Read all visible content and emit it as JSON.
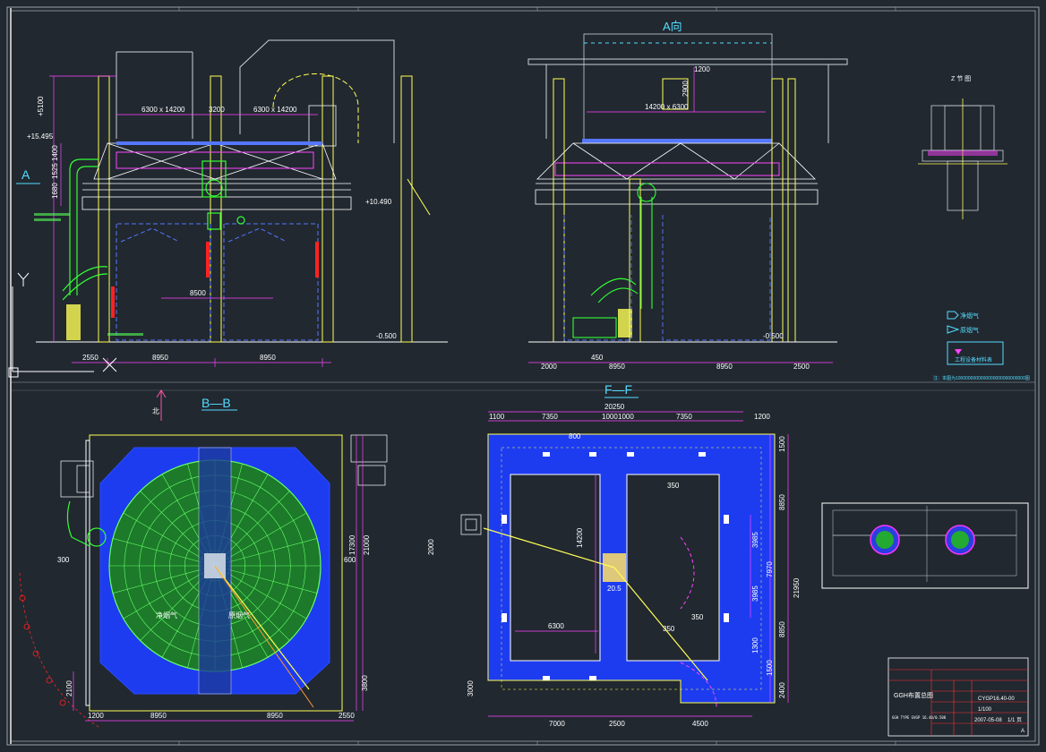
{
  "drawing": {
    "side_view": {
      "dims": {
        "h1": "6300 x 14200",
        "h2": "3200",
        "h3": "6300 x 14200",
        "v_total": "+5100",
        "b1": "2550",
        "b2": "8950",
        "b3": "8950",
        "inner": "8500",
        "el1": "+15.495",
        "el2": "+10.490",
        "el3": "-0.500",
        "v1": "1400",
        "v2": "1525",
        "v3": "1680"
      },
      "section_mark": "A"
    },
    "a_view": {
      "title": "A向",
      "dims": {
        "t1": "1200",
        "t2": "14200 x 6300",
        "t3": "2900",
        "b1": "2000",
        "b2": "450",
        "b3": "8950",
        "b4": "8950",
        "b5": "2500",
        "el": "-0.500"
      }
    },
    "detail_view": {
      "title": "Z 节 图"
    },
    "legend": {
      "item1": "净烟气",
      "item2": "原烟气",
      "box_label": "工程设备材料表",
      "note": "注：本图为1000000000000000000000000000图"
    },
    "bb_view": {
      "title": "B—B",
      "north": "北",
      "label_clean": "净烟气",
      "label_raw": "原烟气",
      "dims": {
        "b1": "1200",
        "b2": "8950",
        "b3": "8950",
        "b4": "2550",
        "r1": "17300",
        "r2": "21000",
        "r3": "3800",
        "l1": "2100",
        "l2": "600",
        "l3": "300"
      }
    },
    "ff_view": {
      "title": "F—F",
      "dims": {
        "top_total": "20250",
        "t1": "1100",
        "t2": "7350",
        "t3": "1000",
        "t4": "1000",
        "t5": "7350",
        "t6": "1200",
        "b1": "7000",
        "b2": "2500",
        "b3": "4500",
        "r1": "1500",
        "r2": "8850",
        "r3": "3985",
        "r4": "7970",
        "r5": "3985",
        "r6": "8850",
        "r7": "1300",
        "r8": "1500",
        "r9": "2400",
        "r10": "21950",
        "w1": "6300",
        "i1": "800",
        "i2": "350",
        "i3": "350",
        "i4": "350",
        "i5": "14200",
        "l1": "2000",
        "l2": "3000",
        "c1": "20.5"
      }
    },
    "title_block": {
      "title": "GGH布置总图",
      "subtitle": "GGH TYPE GVGP 16.40/0.508",
      "code": "CYGP16.40-00",
      "scale": "1/100",
      "date": "2007-05-08",
      "sheet": "1/1 页",
      "rev": "A"
    }
  }
}
